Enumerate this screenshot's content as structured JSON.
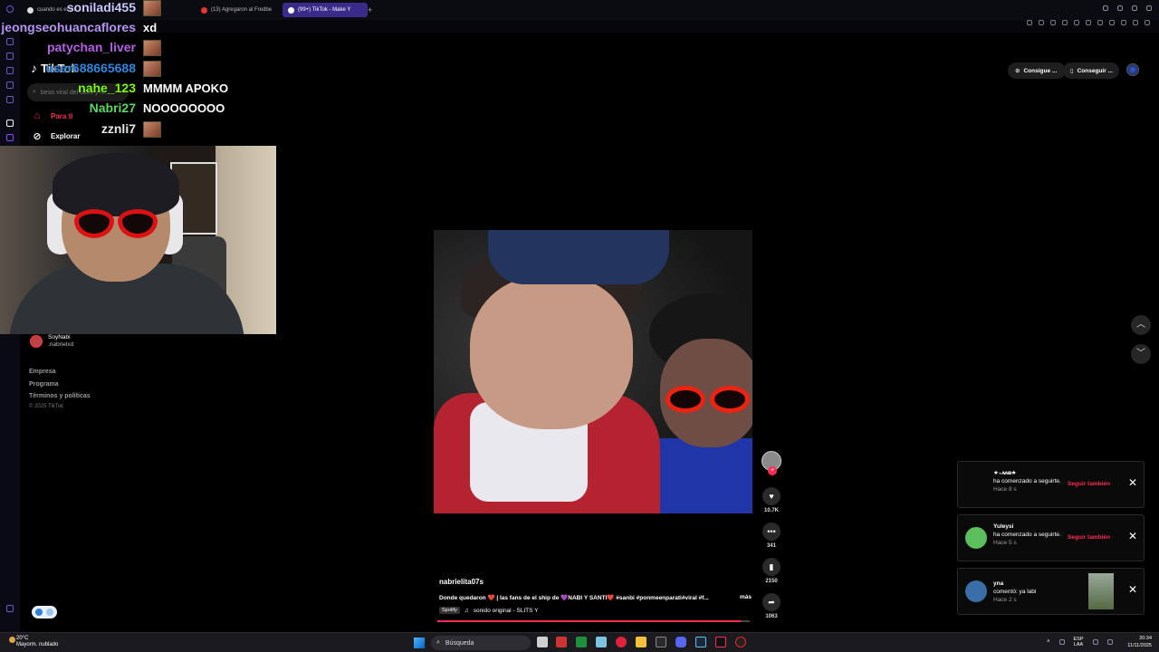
{
  "browser": {
    "tabs": [
      {
        "label": "cuando es el dia...",
        "active": false
      },
      {
        "label": "(13) Agregaron al Fredbe",
        "active": false
      },
      {
        "label": "(99+) TikTok - Make Y",
        "active": true
      }
    ],
    "new_tab": "+"
  },
  "chat": [
    {
      "user": "soniladi455",
      "color": "#c8c8ff",
      "message": "",
      "emote": true
    },
    {
      "user": "jeongseohuancaflores",
      "color": "#b794f6",
      "message": "xd",
      "emote": false
    },
    {
      "user": "patychan_liver",
      "color": "#b45ee6",
      "message": "",
      "emote": true
    },
    {
      "user": "user688665688",
      "color": "#2e86de",
      "message": "",
      "emote": true
    },
    {
      "user": "nahe_123",
      "color": "#7cfc00",
      "message": "MMMM APOKO",
      "emote": false
    },
    {
      "user": "Nabri27",
      "color": "#5bd85b",
      "message": "NOOOOOOOO",
      "emote": false
    },
    {
      "user": "zznli7",
      "color": "#e6e6e6",
      "message": "",
      "emote": true
    }
  ],
  "tiktok": {
    "logo": "TikTok",
    "search_placeholder": "beso viral del santi y n...",
    "nav": {
      "for_you": "Para ti",
      "explore": "Explorar"
    },
    "following": {
      "name": "SoyNabi",
      "handle": ".nabrielxd"
    },
    "footer": {
      "company": "Empresa",
      "program": "Programa",
      "terms": "Términos y políticas",
      "copyright": "© 2025 TikTok"
    },
    "top_pills": {
      "coins": "Consigue ...",
      "app": "Conseguir ..."
    }
  },
  "video": {
    "username": "nabrielita07s",
    "description": "Donde quedaron ❤️ | las fans de el ship de 💜NABI Y SANTI❤️ #sanbi #ponmeenparati#viral #f...",
    "more": "más",
    "sound_badge": "Spotify",
    "sound": "sonido original - SLITS Y",
    "progress": 0.97,
    "actions": {
      "likes": "10.7K",
      "comments": "341",
      "saves": "2150",
      "shares": "1063"
    }
  },
  "notifications": [
    {
      "name": "★₊ᴀ̷ɴ̷ɪ̷★",
      "text": "ha comenzado a seguirte.",
      "time": "Hace 8 s",
      "action": "Seguir también",
      "avatar_color": "#0a0a0a"
    },
    {
      "name": "Yuleysi",
      "text": "ha comenzado a seguirte.",
      "time": "Hace 5 s",
      "action": "Seguir también",
      "avatar_color": "#5bbf5b"
    },
    {
      "name": "yna",
      "text": "comentó: ya labi",
      "time": "Hace 2 s",
      "action": "",
      "avatar_color": "#3a6ea8"
    }
  ],
  "taskbar": {
    "temp": "20°C",
    "weather": "Mayorm. nublado",
    "search": "Búsqueda",
    "lang_top": "ESP",
    "lang_bottom": "LAA",
    "time": "20:34",
    "date": "11/11/2025"
  }
}
